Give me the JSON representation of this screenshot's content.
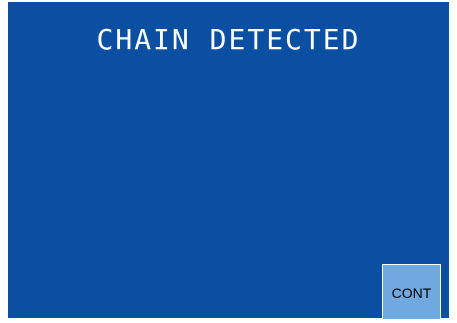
{
  "screen": {
    "title": "CHAIN DETECTED",
    "background_color": "#0b4fa3",
    "text_color": "#ffffff"
  },
  "controls": {
    "cont_label": "CONT",
    "cont_button_color": "#6fa9e0"
  }
}
